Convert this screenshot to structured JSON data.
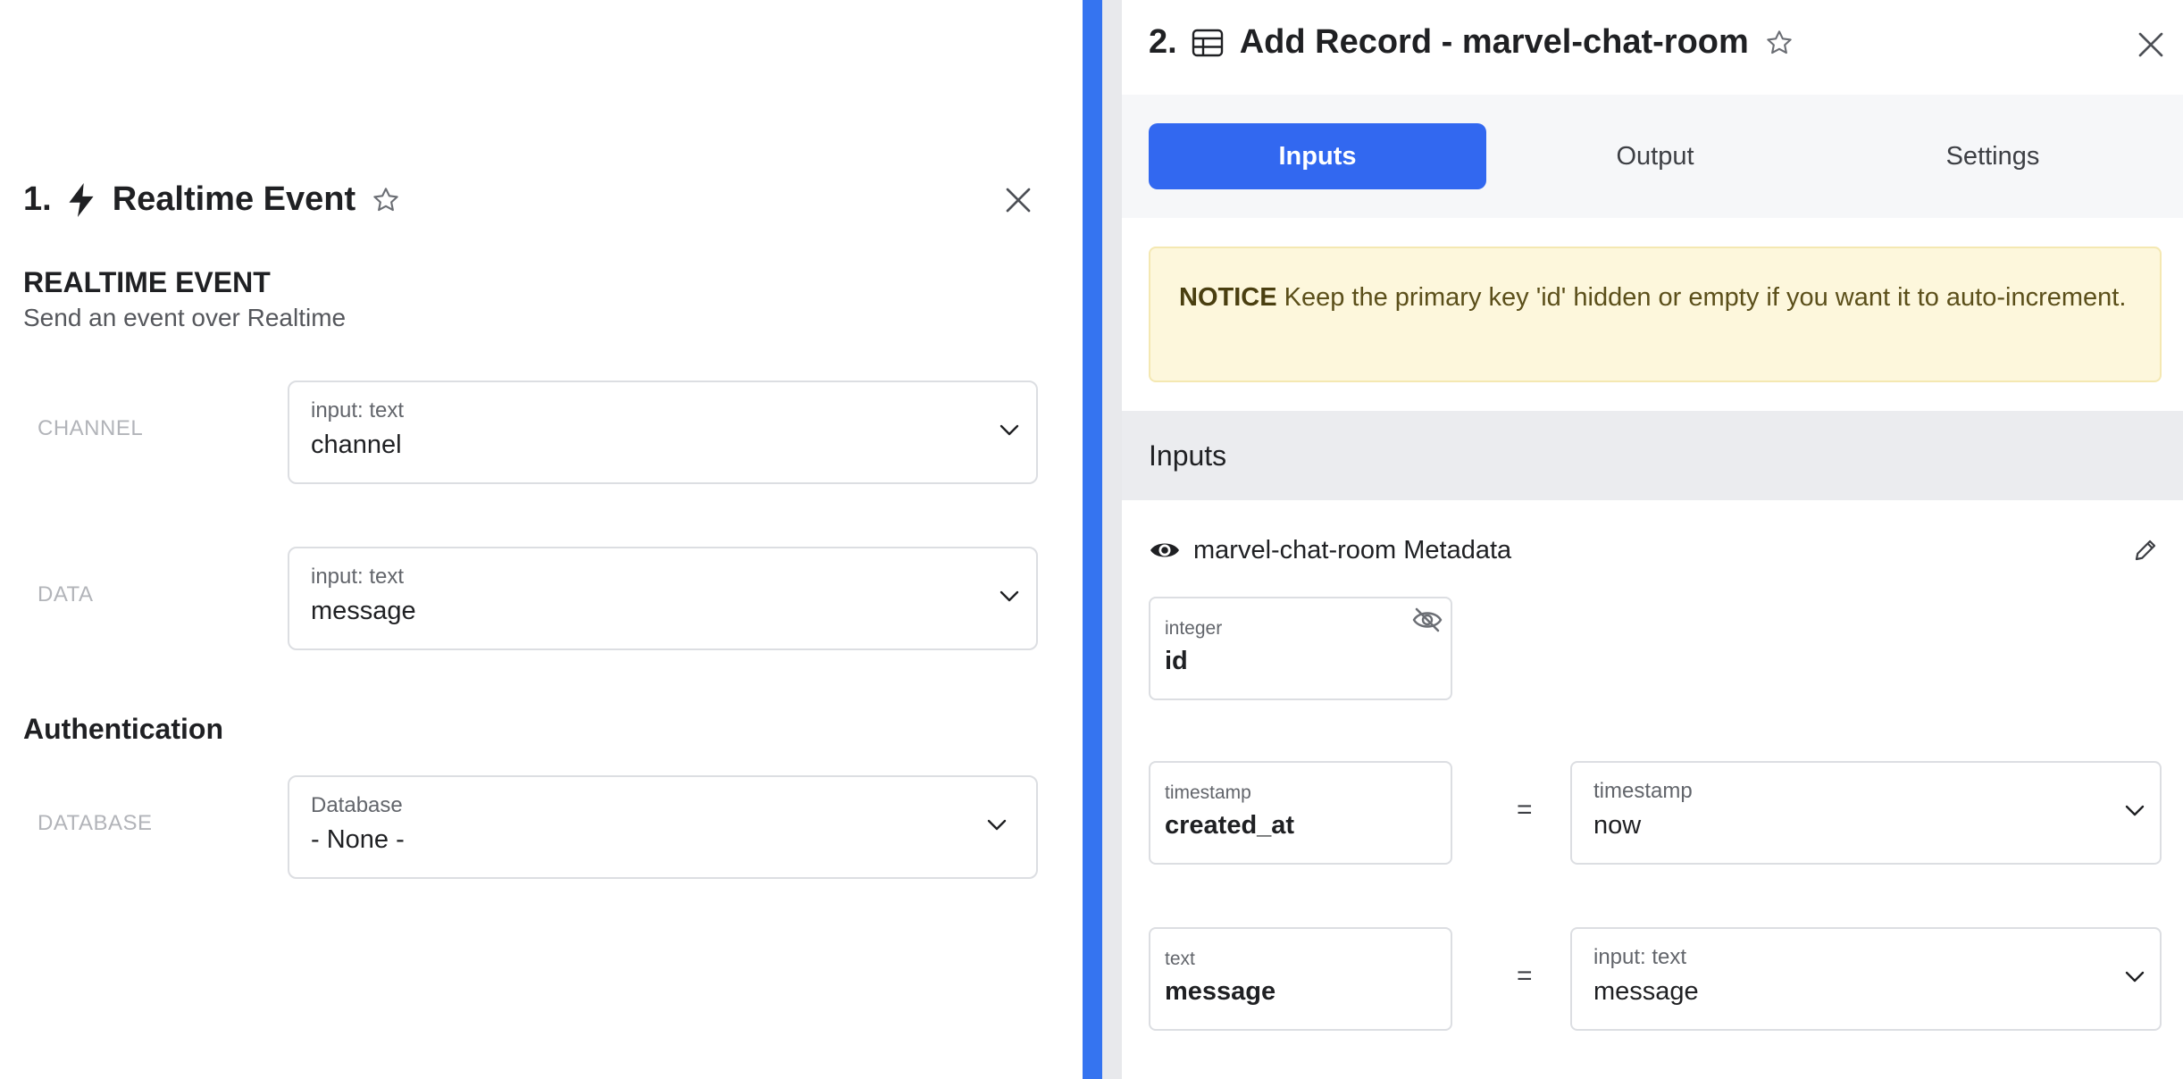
{
  "left": {
    "number": "1.",
    "title": "Realtime Event",
    "section_title": "REALTIME EVENT",
    "section_subtitle": "Send an event over Realtime",
    "fields": [
      {
        "label": "CHANNEL",
        "type_label": "input: text",
        "value": "channel"
      },
      {
        "label": "DATA",
        "type_label": "input: text",
        "value": "message"
      }
    ],
    "auth_title": "Authentication",
    "auth_field": {
      "label": "DATABASE",
      "type_label": "Database",
      "value": "- None -"
    }
  },
  "right": {
    "number": "2.",
    "title": "Add Record - marvel-chat-room",
    "tabs": [
      {
        "label": "Inputs",
        "active": true
      },
      {
        "label": "Output",
        "active": false
      },
      {
        "label": "Settings",
        "active": false
      }
    ],
    "notice": {
      "bold": "NOTICE",
      "text": "Keep the primary key 'id' hidden or empty if you want it to auto-increment."
    },
    "inputs_header": "Inputs",
    "metadata_label": "marvel-chat-room Metadata",
    "columns": [
      {
        "type": "integer",
        "name": "id"
      },
      {
        "type": "timestamp",
        "name": "created_at",
        "equals": "=",
        "value_type": "timestamp",
        "value": "now"
      },
      {
        "type": "text",
        "name": "message",
        "equals": "=",
        "value_type": "input: text",
        "value": "message"
      }
    ]
  },
  "colors": {
    "accent": "#3268f0",
    "divider": "#3574f0",
    "notice_bg": "#fdf7dc",
    "inputs_header_bg": "#ebecef"
  },
  "icons": {
    "left_title_icon": "lightning-bolt-icon",
    "right_title_icon": "table-icon",
    "star": "star-outline-icon",
    "close": "close-icon",
    "chevron": "chevron-down-icon",
    "eye": "eye-icon",
    "eye_off": "eye-off-icon",
    "pencil": "pencil-icon"
  }
}
